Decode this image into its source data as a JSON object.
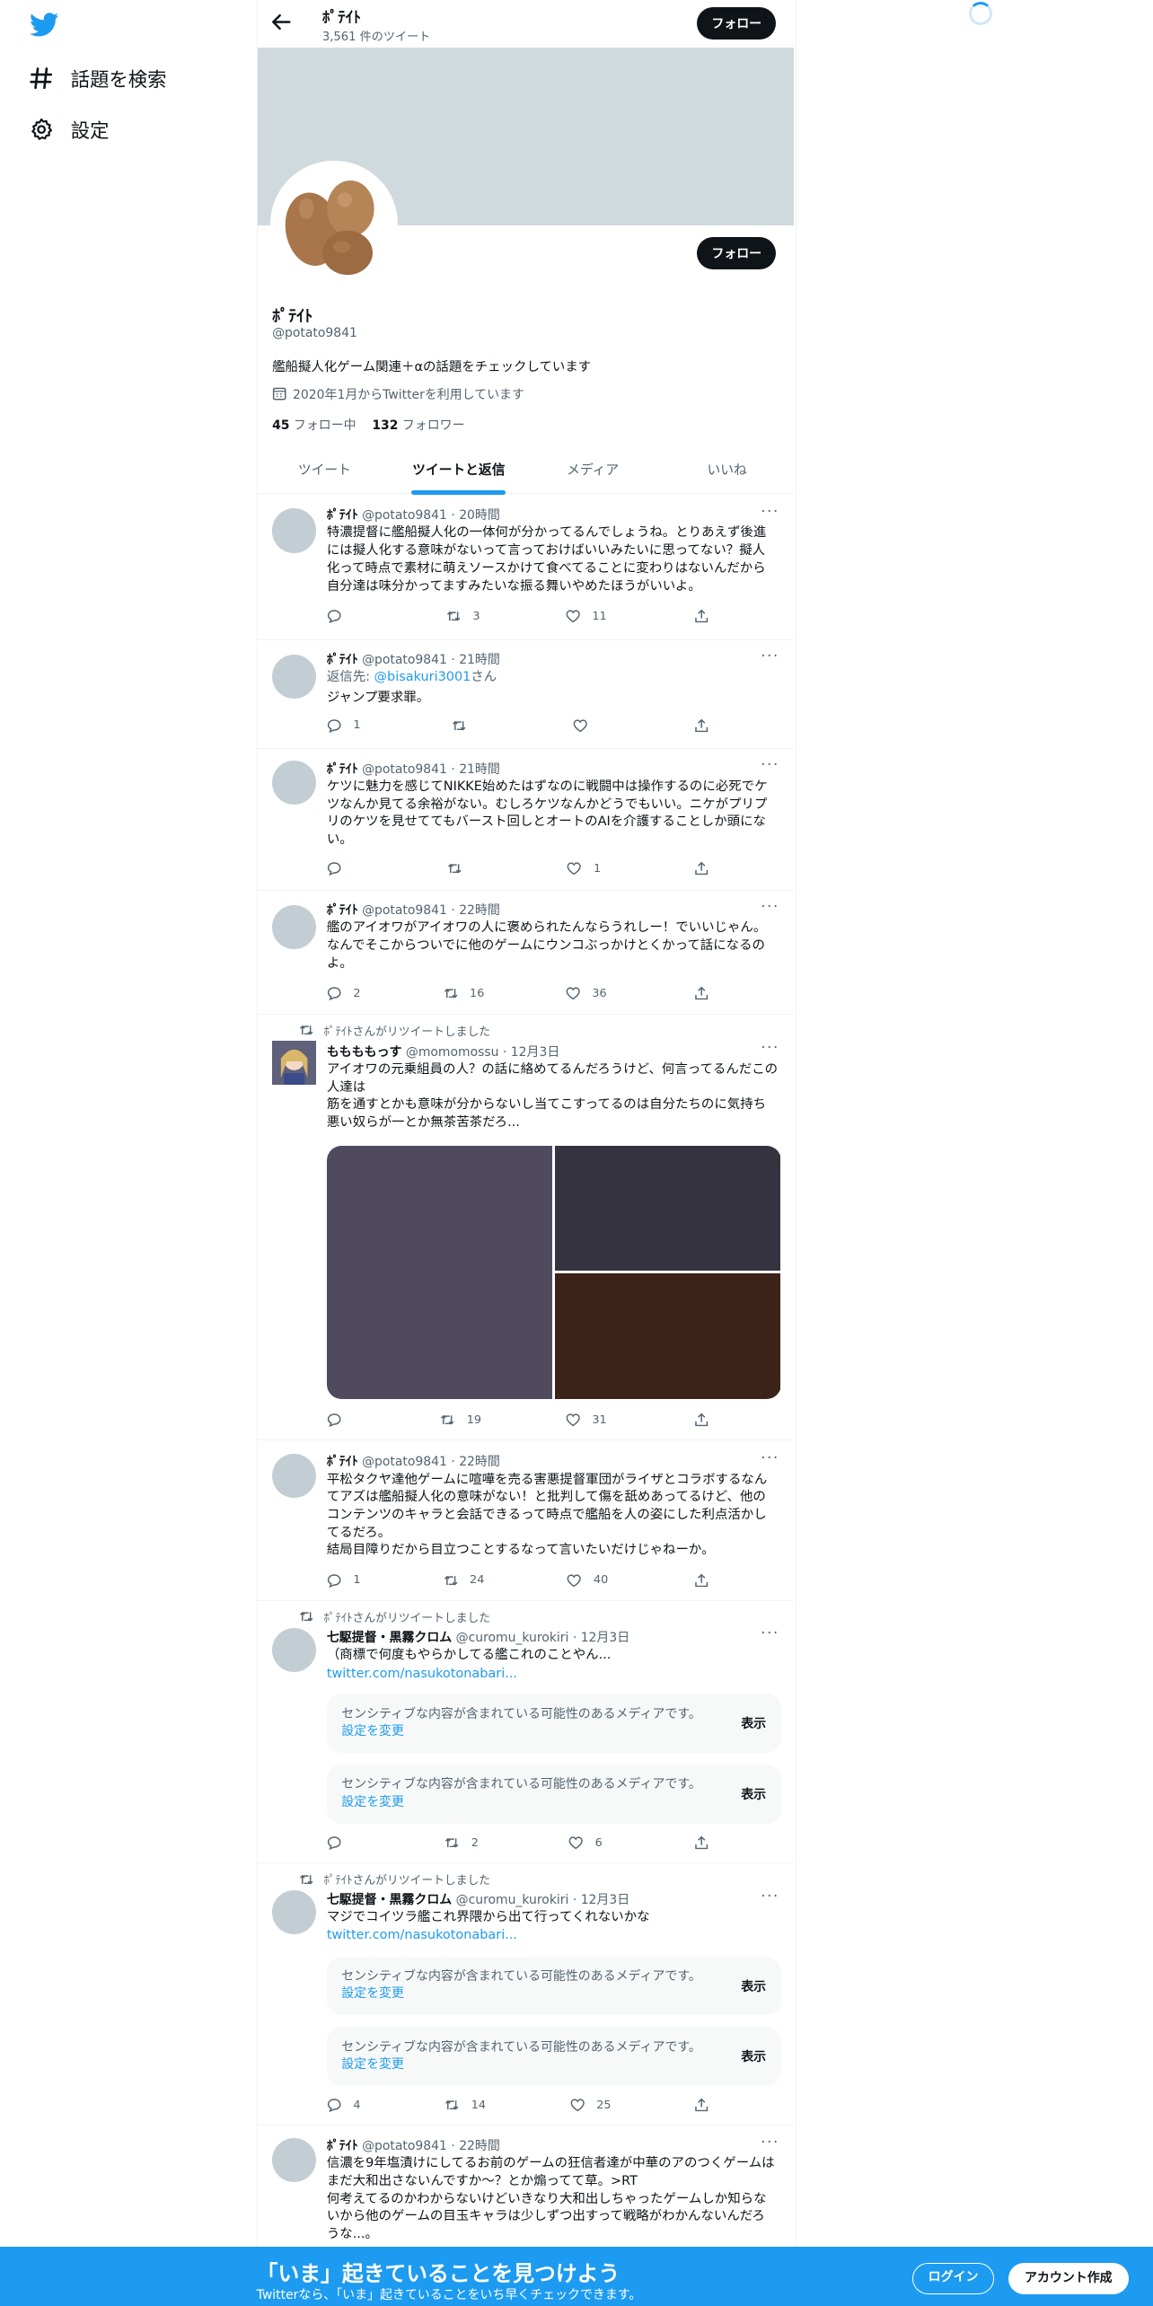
{
  "sidebar": {
    "explore_label": "話題を検索",
    "settings_label": "設定"
  },
  "header": {
    "name": "ﾎﾟﾃｲﾄ",
    "tweet_count": "3,561 件のツイート",
    "follow_label": "フォロー"
  },
  "profile": {
    "name": "ﾎﾟﾃｲﾄ",
    "handle": "@potato9841",
    "bio": "艦船擬人化ゲーム関連＋αの話題をチェックしています",
    "joined": "2020年1月からTwitterを利用しています",
    "following_count": "45",
    "following_label": " フォロー中",
    "followers_count": "132",
    "followers_label": " フォロワー",
    "follow_label": "フォロー"
  },
  "tabs": [
    "ツイート",
    "ツイートと返信",
    "メディア",
    "いいね"
  ],
  "tweets": [
    {
      "name": "ﾎﾟﾃｲﾄ",
      "handle": "@potato9841",
      "time": "20時間",
      "text": "特濃提督に艦船擬人化の一体何が分かってるんでしょうね。とりあえず後進には擬人化する意味がないって言っておけばいいみたいに思ってない？擬人化って時点で素材に萌えソースかけて食べてることに変わりはないんだから自分達は味分かってますみたいな振る舞いやめたほうがいいよ。",
      "replies": "",
      "retweets": "3",
      "likes": "11"
    },
    {
      "name": "ﾎﾟﾃｲﾄ",
      "handle": "@potato9841",
      "time": "21時間",
      "reply_prefix": "返信先: ",
      "reply_to": "@bisakuri3001",
      "reply_suffix": "さん",
      "text": "ジャンプ要求罪。",
      "replies": "1",
      "retweets": "",
      "likes": ""
    },
    {
      "name": "ﾎﾟﾃｲﾄ",
      "handle": "@potato9841",
      "time": "21時間",
      "text": "ケツに魅力を感じてNIKKE始めたはずなのに戦闘中は操作するのに必死でケツなんか見てる余裕がない。むしろケツなんかどうでもいい。ニケがプリプリのケツを見せててもバースト回しとオートのAIを介護することしか頭にない。",
      "replies": "",
      "retweets": "",
      "likes": "1"
    },
    {
      "name": "ﾎﾟﾃｲﾄ",
      "handle": "@potato9841",
      "time": "22時間",
      "text": "艦のアイオワがアイオワの人に褒められたんならうれしー！でいいじゃん。なんでそこからついでに他のゲームにウンコぶっかけとくかって話になるのよ。",
      "replies": "2",
      "retweets": "16",
      "likes": "36"
    },
    {
      "rt_label": "ﾎﾟﾃｲﾄさんがリツイートしました",
      "name": "ももももっす",
      "handle": "@momomossu",
      "time": "12月3日",
      "text": "アイオワの元乗組員の人？の話に絡めてるんだろうけど、何言ってるんだこの人達は\n筋を通すとかも意味が分からないし当てこすってるのは自分たちのに気持ち悪い奴らが一とか無茶苦茶だろ...",
      "replies": "",
      "retweets": "19",
      "likes": "31"
    },
    {
      "name": "ﾎﾟﾃｲﾄ",
      "handle": "@potato9841",
      "time": "22時間",
      "text": "平松タクヤ達他ゲームに喧嘩を売る害悪提督軍団がライザとコラボするなんてアズは艦船擬人化の意味がない！と批判して傷を舐めあってるけど、他のコンテンツのキャラと会話できるって時点で艦船を人の姿にした利点活かしてるだろ。\n結局目障りだから目立つことするなって言いたいだけじゃねーか。",
      "replies": "1",
      "retweets": "24",
      "likes": "40"
    },
    {
      "rt_label": "ﾎﾟﾃｲﾄさんがリツイートしました",
      "name": "七駆提督・黒霧クロム",
      "handle": "@curomu_kurokiri",
      "time": "12月3日",
      "text": "（商標で何度もやらかしてる艦これのことやん...",
      "link": "twitter.com/nasukotonabari...",
      "sensitive_text": "センシティブな内容が含まれている可能性のあるメディアです。",
      "sensitive_link": "設定を変更",
      "show_label": "表示",
      "replies": "",
      "retweets": "2",
      "likes": "6"
    },
    {
      "rt_label": "ﾎﾟﾃｲﾄさんがリツイートしました",
      "name": "七駆提督・黒霧クロム",
      "handle": "@curomu_kurokiri",
      "time": "12月3日",
      "text": "マジでコイツラ艦これ界隈から出て行ってくれないかな",
      "link": "twitter.com/nasukotonabari...",
      "sensitive_text": "センシティブな内容が含まれている可能性のあるメディアです。",
      "sensitive_link": "設定を変更",
      "show_label": "表示",
      "replies": "4",
      "retweets": "14",
      "likes": "25"
    },
    {
      "name": "ﾎﾟﾃｲﾄ",
      "handle": "@potato9841",
      "time": "22時間",
      "text": "信濃を9年塩漬けにしてるお前のゲームの狂信者達が中華のアのつくゲームはまだ大和出さないんですか～？とか煽ってて草。>RT\n何考えてるのかわからないけどいきなり大和出しちゃったゲームしか知らないから他のゲームの目玉キャラは少しずつ出すって戦略がわかんないんだろうな...。"
    }
  ],
  "bottom": {
    "title": "「いま」起きていることを見つけよう",
    "subtitle": "Twitterなら、「いま」起きていることをいち早くチェックできます。",
    "login_label": "ログイン",
    "signup_label": "アカウント作成"
  },
  "colors": {
    "accent": "#1d9bf0",
    "text": "#0f1419",
    "muted": "#536471",
    "banner": "#cfd9de"
  }
}
